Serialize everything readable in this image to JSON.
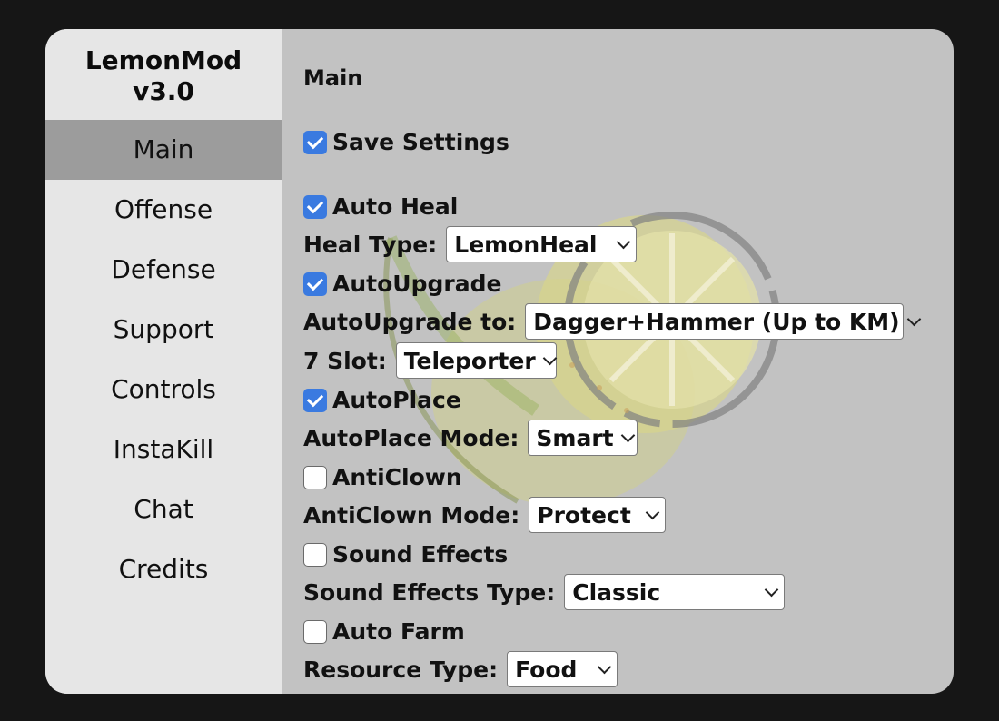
{
  "app": {
    "name": "LemonMod",
    "version": "v3.0"
  },
  "nav": [
    {
      "label": "Main",
      "active": true
    },
    {
      "label": "Offense"
    },
    {
      "label": "Defense"
    },
    {
      "label": "Support"
    },
    {
      "label": "Controls"
    },
    {
      "label": "InstaKill"
    },
    {
      "label": "Chat"
    },
    {
      "label": "Credits"
    }
  ],
  "main": {
    "title": "Main",
    "save_settings": {
      "label": "Save Settings",
      "checked": true
    },
    "auto_heal": {
      "label": "Auto Heal",
      "checked": true
    },
    "heal_type": {
      "label": "Heal Type:",
      "value": "LemonHeal"
    },
    "auto_upgrade": {
      "label": "AutoUpgrade",
      "checked": true
    },
    "auto_upgrade_to": {
      "label": "AutoUpgrade to:",
      "value": "Dagger+Hammer (Up to KM)"
    },
    "slot7": {
      "label": "7 Slot:",
      "value": "Teleporter"
    },
    "auto_place": {
      "label": "AutoPlace",
      "checked": true
    },
    "auto_place_mode": {
      "label": "AutoPlace Mode:",
      "value": "Smart"
    },
    "anti_clown": {
      "label": "AntiClown",
      "checked": false
    },
    "anti_clown_mode": {
      "label": "AntiClown Mode:",
      "value": "Protect"
    },
    "sound_effects": {
      "label": "Sound Effects",
      "checked": false
    },
    "sound_effects_type": {
      "label": "Sound Effects Type:",
      "value": "Classic"
    },
    "auto_farm": {
      "label": "Auto Farm",
      "checked": false
    },
    "resource_type": {
      "label": "Resource Type:",
      "value": "Food"
    }
  },
  "colors": {
    "checkbox_on": "#3a7ae0",
    "active_nav": "#9c9c9c",
    "sidebar": "#e6e6e6",
    "content": "#c2c2c2"
  }
}
